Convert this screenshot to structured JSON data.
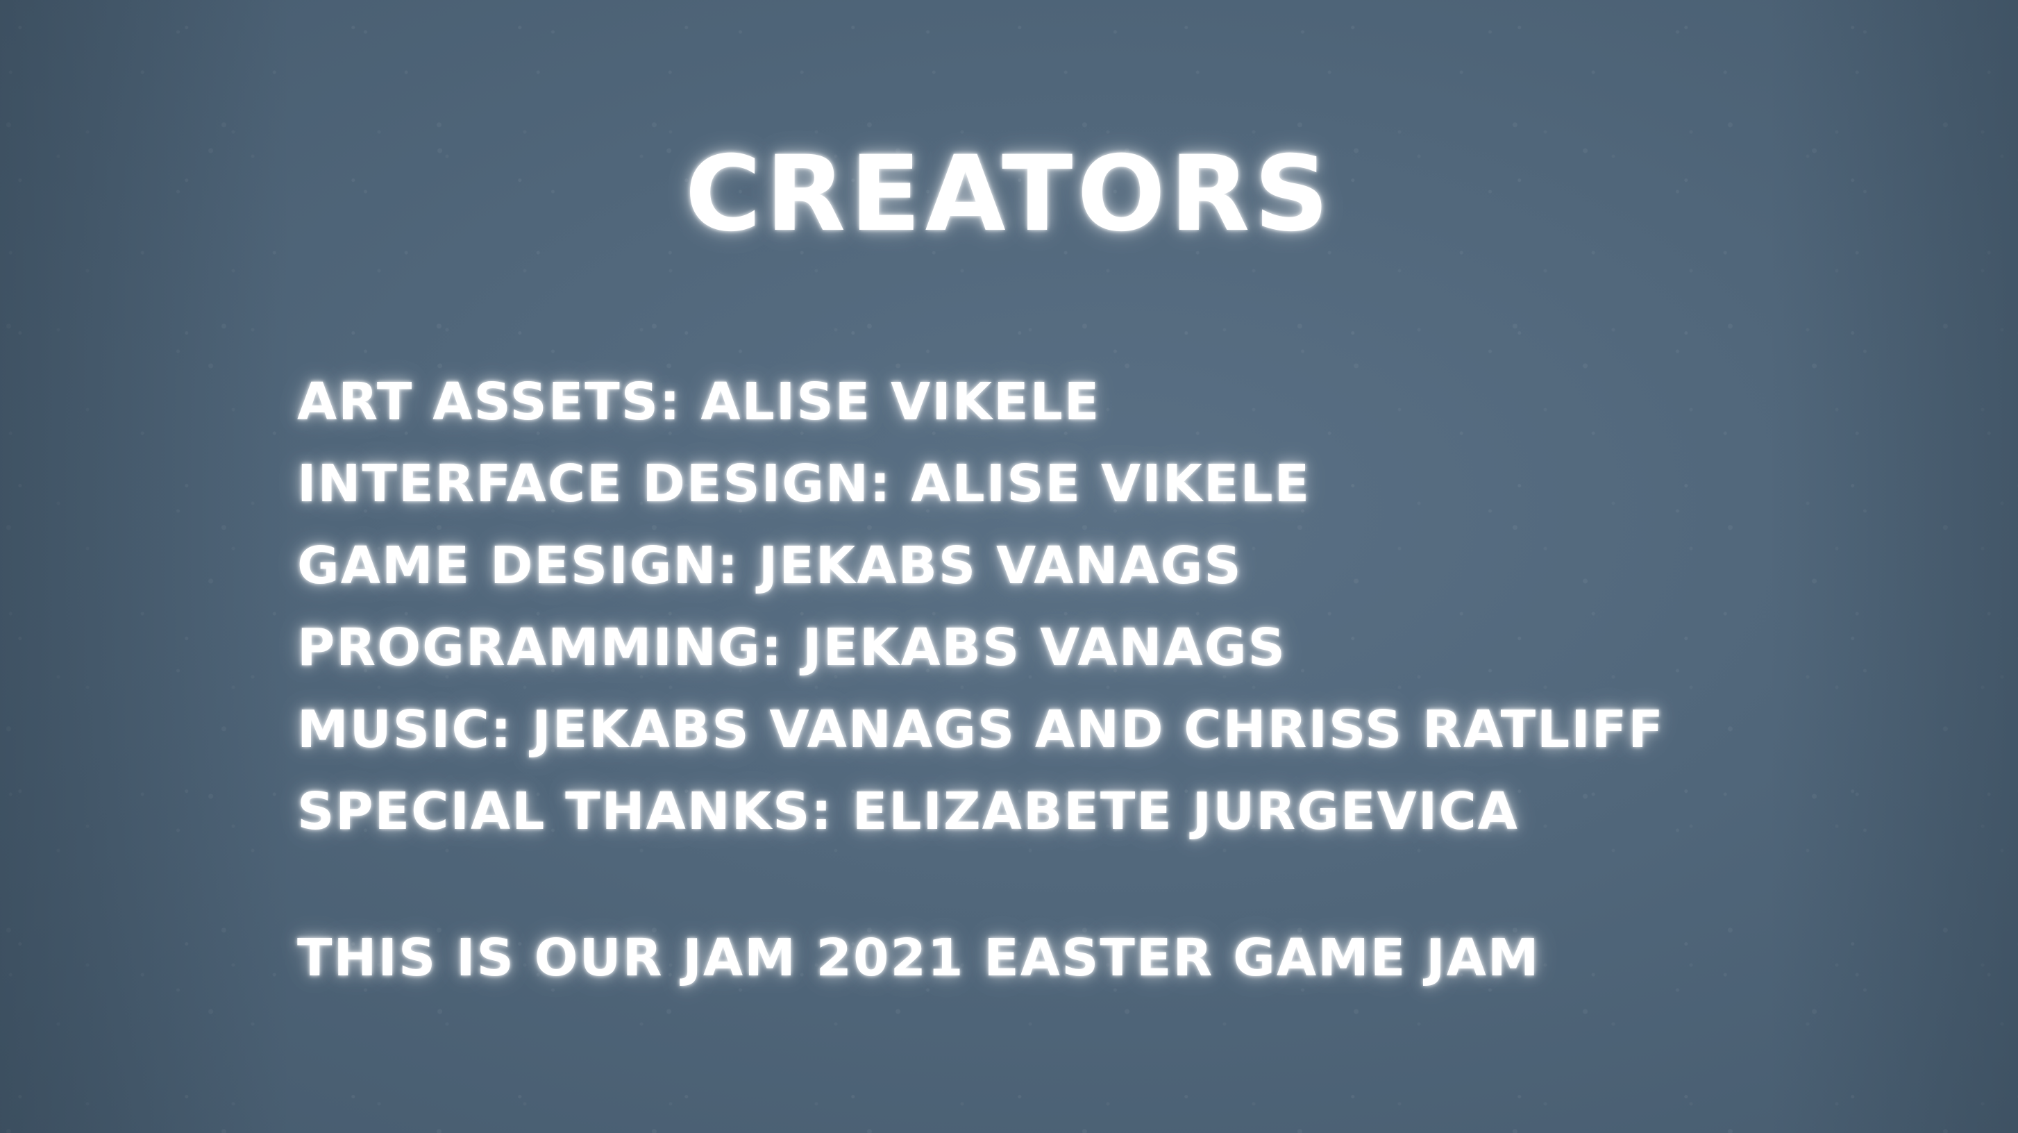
{
  "screen": {
    "title": "CREATORS",
    "credits": [
      "ART ASSETS: ALISE VIKELE",
      "INTERFACE DESIGN: ALISE VIKELE",
      "GAME DESIGN: JEKABS VANAGS",
      "PROGRAMMING: JEKABS VANAGS",
      "MUSIC: JEKABS VANAGS AND CHRISS RATLIFF",
      "SPECIAL THANKS: ELIZABETE JURGEVICA"
    ],
    "note": "THIS IS OUR JAM 2021 EASTER GAME JAM"
  },
  "colors": {
    "background": "#51677b",
    "text": "#ffffff"
  }
}
